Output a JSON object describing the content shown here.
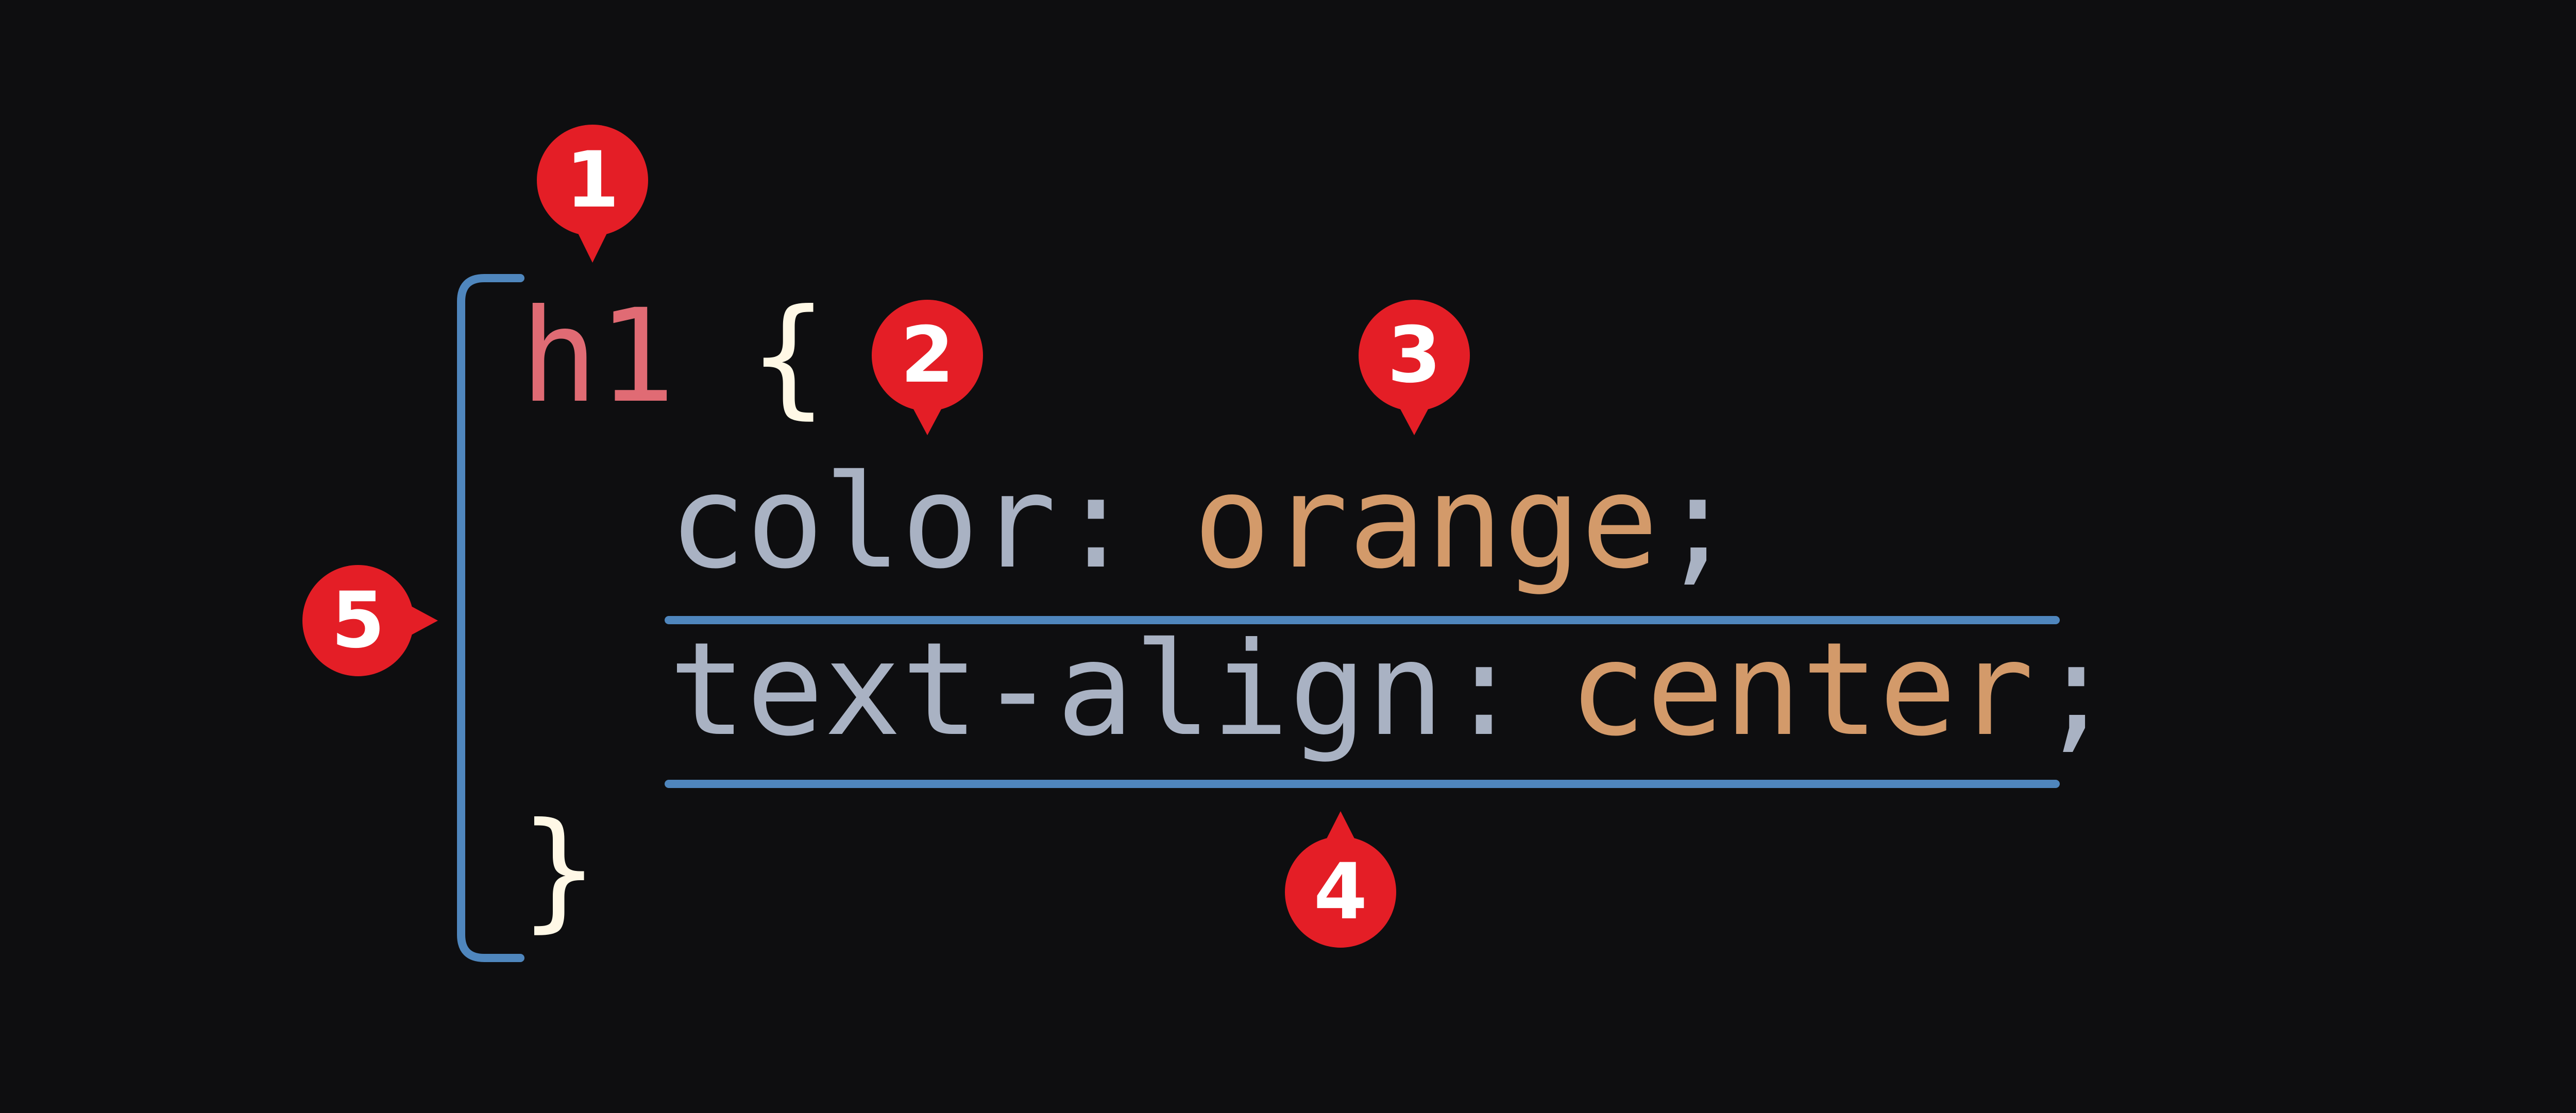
{
  "colors": {
    "background": "#0e0e10",
    "selector": "#e06b74",
    "brace": "#fff8e6",
    "property": "#a9b2c3",
    "value": "#d39a6a",
    "bracket_line": "#4f86bd",
    "marker_fill": "#e41e26",
    "marker_text": "#ffffff"
  },
  "code": {
    "selector": "h1",
    "open_brace": "{",
    "close_brace": "}",
    "declarations": [
      {
        "property": "color",
        "colon": ":",
        "value": "orange",
        "semicolon": ";"
      },
      {
        "property": "text-align",
        "colon": ":",
        "value": "center",
        "semicolon": ";"
      }
    ]
  },
  "markers": {
    "selector": "1",
    "open_brace": "2",
    "value": "3",
    "declaration": "4",
    "rule": "5"
  }
}
